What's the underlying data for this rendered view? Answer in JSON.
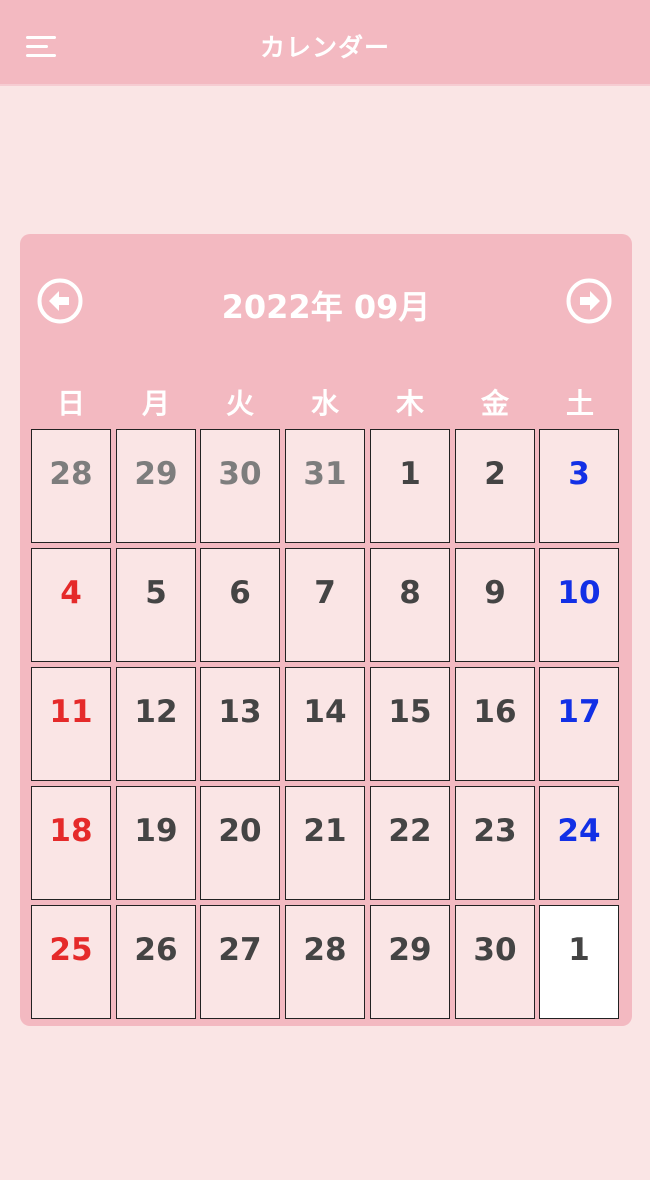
{
  "app": {
    "title": "カレンダー",
    "menu_icon": "hamburger-menu-icon"
  },
  "calendar": {
    "month_title": "2022年 09月",
    "prev_icon": "arrow-left-circle-icon",
    "next_icon": "arrow-right-circle-icon",
    "weekdays": [
      "日",
      "月",
      "火",
      "水",
      "木",
      "金",
      "土"
    ],
    "weeks": [
      [
        {
          "day": "28",
          "type": "outside"
        },
        {
          "day": "29",
          "type": "outside"
        },
        {
          "day": "30",
          "type": "outside"
        },
        {
          "day": "31",
          "type": "outside"
        },
        {
          "day": "1",
          "type": "normal"
        },
        {
          "day": "2",
          "type": "normal"
        },
        {
          "day": "3",
          "type": "saturday"
        }
      ],
      [
        {
          "day": "4",
          "type": "sunday"
        },
        {
          "day": "5",
          "type": "normal"
        },
        {
          "day": "6",
          "type": "normal"
        },
        {
          "day": "7",
          "type": "normal"
        },
        {
          "day": "8",
          "type": "normal"
        },
        {
          "day": "9",
          "type": "normal"
        },
        {
          "day": "10",
          "type": "saturday"
        }
      ],
      [
        {
          "day": "11",
          "type": "sunday"
        },
        {
          "day": "12",
          "type": "normal"
        },
        {
          "day": "13",
          "type": "normal"
        },
        {
          "day": "14",
          "type": "normal"
        },
        {
          "day": "15",
          "type": "normal"
        },
        {
          "day": "16",
          "type": "normal"
        },
        {
          "day": "17",
          "type": "saturday"
        }
      ],
      [
        {
          "day": "18",
          "type": "sunday"
        },
        {
          "day": "19",
          "type": "normal"
        },
        {
          "day": "20",
          "type": "normal"
        },
        {
          "day": "21",
          "type": "normal"
        },
        {
          "day": "22",
          "type": "normal"
        },
        {
          "day": "23",
          "type": "normal"
        },
        {
          "day": "24",
          "type": "saturday"
        }
      ],
      [
        {
          "day": "25",
          "type": "sunday"
        },
        {
          "day": "26",
          "type": "normal"
        },
        {
          "day": "27",
          "type": "normal"
        },
        {
          "day": "28",
          "type": "normal"
        },
        {
          "day": "29",
          "type": "normal"
        },
        {
          "day": "30",
          "type": "normal"
        },
        {
          "day": "1",
          "type": "today"
        }
      ]
    ]
  },
  "colors": {
    "header_pink": "#f3b9c1",
    "background": "#fae5e5",
    "sunday_red": "#e52a2a",
    "saturday_blue": "#1230e6",
    "text_dark": "#444444",
    "text_outside": "#7d7d7d",
    "today_bg": "#ffffff"
  }
}
